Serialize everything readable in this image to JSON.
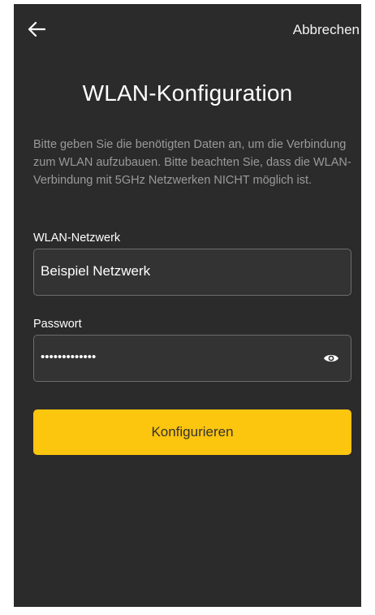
{
  "header": {
    "back_icon": "arrow-left-icon",
    "cancel_label": "Abbrechen"
  },
  "title": "WLAN-Konfiguration",
  "info_text": "Bitte geben Sie die benötigten Daten an, um die Verbindung zum WLAN aufzubauen. Bitte beachten Sie, dass die WLAN-Verbindung mit 5GHz Netzwerken NICHT möglich ist.",
  "form": {
    "ssid_label": "WLAN-Netzwerk",
    "ssid_value": "Beispiel Netzwerk",
    "password_label": "Passwort",
    "password_mask": "•••••••••••••",
    "password_toggle_icon": "eye-icon"
  },
  "submit_label": "Konfigurieren",
  "colors": {
    "background": "#2b2b2b",
    "accent": "#fcc50e",
    "input_border": "#6c6c6c",
    "muted_text": "#9a9a9a"
  }
}
